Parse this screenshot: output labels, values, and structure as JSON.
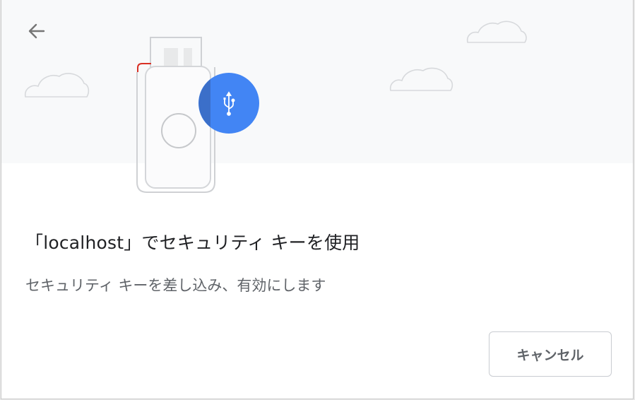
{
  "dialog": {
    "title": "「localhost」でセキュリティ キーを使用",
    "description": "セキュリティ キーを差し込み、有効にします",
    "cancel_label": "キャンセル"
  },
  "icons": {
    "back": "arrow-back-icon",
    "usb_key": "usb-security-key-icon",
    "usb_symbol": "usb-icon",
    "clouds": "cloud-icon"
  },
  "colors": {
    "accent_blue": "#4285f4",
    "accent_blue_dark": "#3b6fc9",
    "illustration_bg": "#f8f9fa",
    "key_red_mark": "#d93025",
    "top_bar_orange": "#f6a253"
  }
}
